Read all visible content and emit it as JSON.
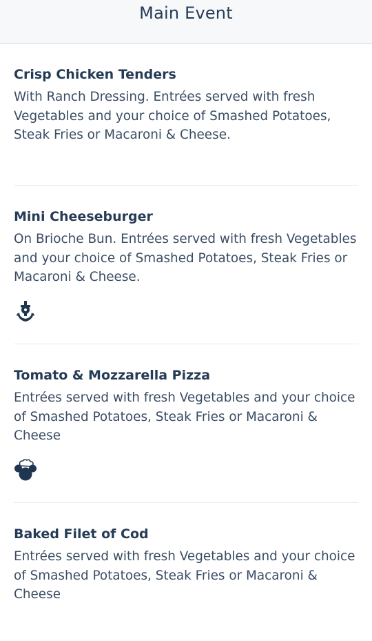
{
  "header": {
    "title": "Main Event"
  },
  "menu": {
    "items": [
      {
        "name": "Crisp Chicken Tenders",
        "description": "With Ranch Dressing. Entrées served with fresh Vegetables and your choice of Smashed Potatoes, Steak Fries or Macaroni & Cheese.",
        "icon": null
      },
      {
        "name": "Mini Cheeseburger",
        "description": "On Brioche Bun. Entrées served with fresh Vegetables and your choice of Smashed Potatoes, Steak Fries or Macaroni & Cheese.",
        "icon": "anchor-icon"
      },
      {
        "name": "Tomato & Mozzarella Pizza",
        "description": "Entrées served with fresh Vegetables and your choice of Smashed Potatoes, Steak Fries or Macaroni & Cheese",
        "icon": "mickey-chef-hat-icon"
      },
      {
        "name": "Baked Filet of Cod",
        "description": "Entrées served with fresh Vegetables and your choice of Smashed Potatoes, Steak Fries or Macaroni & Cheese",
        "icon": null
      }
    ]
  },
  "colors": {
    "text_primary": "#253b56",
    "header_background": "#f7f8fa",
    "divider": "#e6e9ed"
  }
}
